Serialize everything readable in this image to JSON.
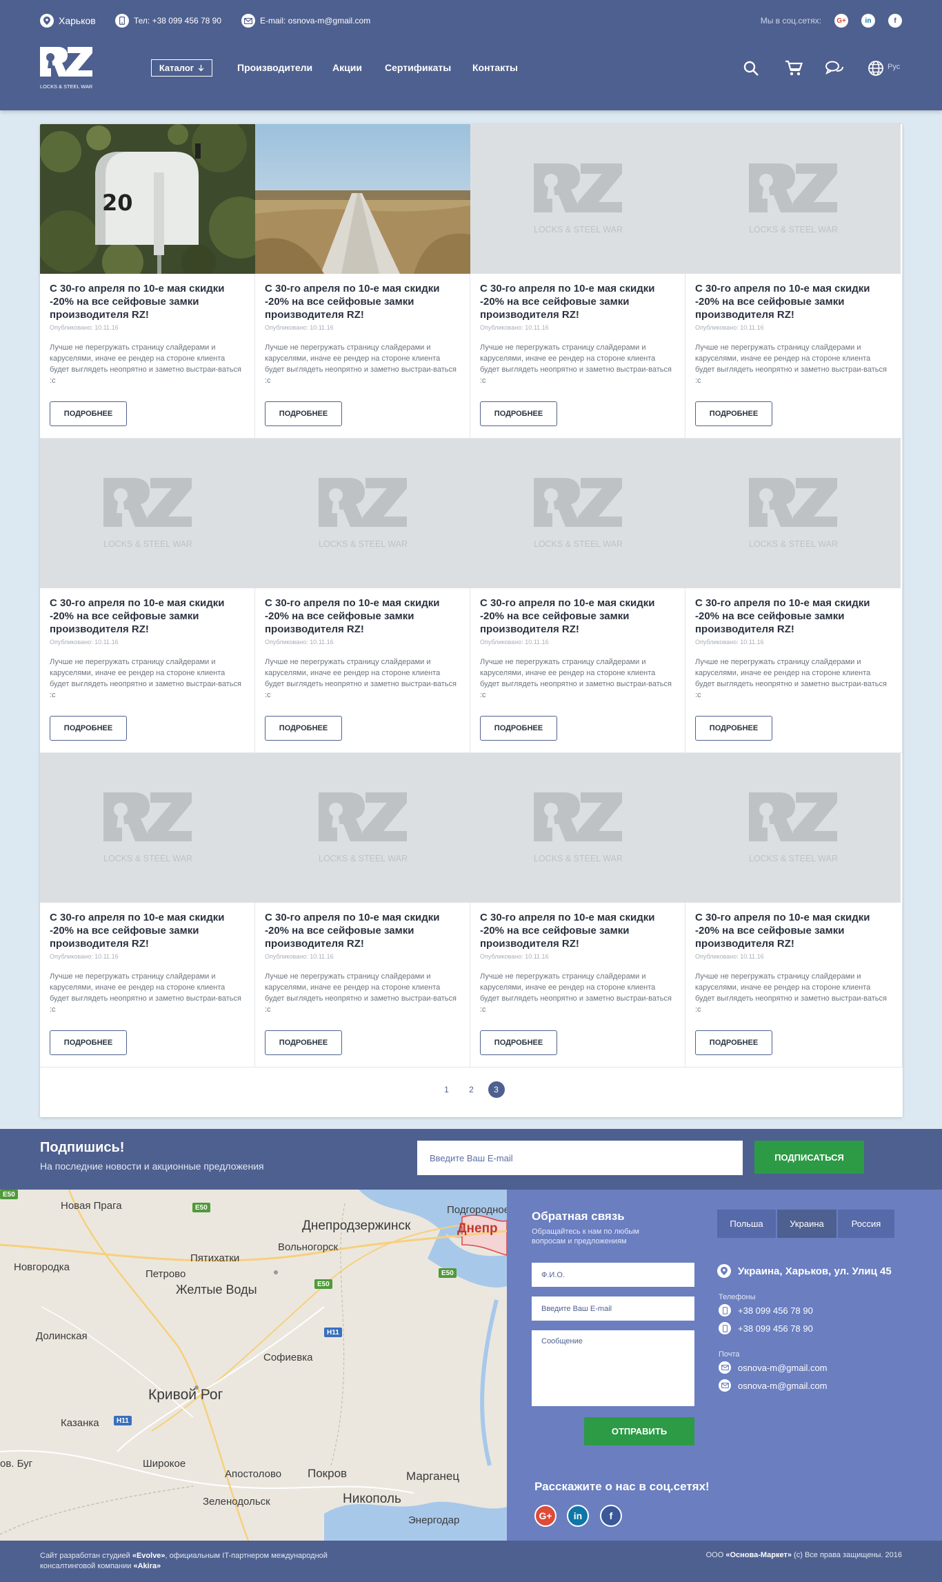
{
  "header": {
    "city": "Харьков",
    "phone": "Тел: +38 099 456 78 90",
    "email": "E-mail: osnova-m@gmail.com",
    "social_label": "Мы в соц.сетях:",
    "social": [
      "G+",
      "in",
      "f"
    ],
    "logo_letters": "RZ",
    "logo_sub": "LOCKS & STEEL WARES",
    "nav": {
      "catalog": "Каталог",
      "manufacturers": "Производители",
      "promotions": "Акции",
      "certificates": "Сертификаты",
      "contacts": "Контакты"
    },
    "language": "Рус"
  },
  "cards": [
    {
      "title": "С 30-го апреля по 10-е мая скидки -20% на все сейфовые замки производителя RZ!",
      "date": "Опубликовано: 10.11.16",
      "text": "Лучше не перегружать страницу слайдерами и каруселями, иначе ее рендер на стороне клиента будет выглядеть неопрятно и заметно выстраи-ваться :c",
      "button": "ПОДРОБНЕЕ",
      "image": "mailbox"
    },
    {
      "title": "С 30-го апреля по 10-е мая скидки -20% на все сейфовые замки производителя RZ!",
      "date": "Опубликовано: 10.11.16",
      "text": "Лучше не перегружать страницу слайдерами и каруселями, иначе ее рендер на стороне клиента будет выглядеть неопрятно и заметно выстраи-ваться :c",
      "button": "ПОДРОБНЕЕ",
      "image": "field"
    },
    {
      "title": "С 30-го апреля по 10-е мая скидки -20% на все сейфовые замки производителя RZ!",
      "date": "Опубликовано: 10.11.16",
      "text": "Лучше не перегружать страницу слайдерами и каруселями, иначе ее рендер на стороне клиента будет выглядеть неопрятно и заметно выстраи-ваться :c",
      "button": "ПОДРОБНЕЕ",
      "image": "placeholder"
    },
    {
      "title": "С 30-го апреля по 10-е мая скидки -20% на все сейфовые замки производителя RZ!",
      "date": "Опубликовано: 10.11.16",
      "text": "Лучше не перегружать страницу слайдерами и каруселями, иначе ее рендер на стороне клиента будет выглядеть неопрятно и заметно выстраи-ваться :c",
      "button": "ПОДРОБНЕЕ",
      "image": "placeholder"
    },
    {
      "title": "С 30-го апреля по 10-е мая скидки -20% на все сейфовые замки производителя RZ!",
      "date": "Опубликовано: 10.11.16",
      "text": "Лучше не перегружать страницу слайдерами и каруселями, иначе ее рендер на стороне клиента будет выглядеть неопрятно и заметно выстраи-ваться :c",
      "button": "ПОДРОБНЕЕ",
      "image": "placeholder"
    },
    {
      "title": "С 30-го апреля по 10-е мая скидки -20% на все сейфовые замки производителя RZ!",
      "date": "Опубликовано: 10.11.16",
      "text": "Лучше не перегружать страницу слайдерами и каруселями, иначе ее рендер на стороне клиента будет выглядеть неопрятно и заметно выстраи-ваться :c",
      "button": "ПОДРОБНЕЕ",
      "image": "placeholder"
    },
    {
      "title": "С 30-го апреля по 10-е мая скидки -20% на все сейфовые замки производителя RZ!",
      "date": "Опубликовано: 10.11.16",
      "text": "Лучше не перегружать страницу слайдерами и каруселями, иначе ее рендер на стороне клиента будет выглядеть неопрятно и заметно выстраи-ваться :c",
      "button": "ПОДРОБНЕЕ",
      "image": "placeholder"
    },
    {
      "title": "С 30-го апреля по 10-е мая скидки -20% на все сейфовые замки производителя RZ!",
      "date": "Опубликовано: 10.11.16",
      "text": "Лучше не перегружать страницу слайдерами и каруселями, иначе ее рендер на стороне клиента будет выглядеть неопрятно и заметно выстраи-ваться :c",
      "button": "ПОДРОБНЕЕ",
      "image": "placeholder"
    },
    {
      "title": "С 30-го апреля по 10-е мая скидки -20% на все сейфовые замки производителя RZ!",
      "date": "Опубликовано: 10.11.16",
      "text": "Лучше не перегружать страницу слайдерами и каруселями, иначе ее рендер на стороне клиента будет выглядеть неопрятно и заметно выстраи-ваться :c",
      "button": "ПОДРОБНЕЕ",
      "image": "placeholder"
    },
    {
      "title": "С 30-го апреля по 10-е мая скидки -20% на все сейфовые замки производителя RZ!",
      "date": "Опубликовано: 10.11.16",
      "text": "Лучше не перегружать страницу слайдерами и каруселями, иначе ее рендер на стороне клиента будет выглядеть неопрятно и заметно выстраи-ваться :c",
      "button": "ПОДРОБНЕЕ",
      "image": "placeholder"
    },
    {
      "title": "С 30-го апреля по 10-е мая скидки -20% на все сейфовые замки производителя RZ!",
      "date": "Опубликовано: 10.11.16",
      "text": "Лучше не перегружать страницу слайдерами и каруселями, иначе ее рендер на стороне клиента будет выглядеть неопрятно и заметно выстраи-ваться :c",
      "button": "ПОДРОБНЕЕ",
      "image": "placeholder"
    },
    {
      "title": "С 30-го апреля по 10-е мая скидки -20% на все сейфовые замки производителя RZ!",
      "date": "Опубликовано: 10.11.16",
      "text": "Лучше не перегружать страницу слайдерами и каруселями, иначе ее рендер на стороне клиента будет выглядеть неопрятно и заметно выстраи-ваться :c",
      "button": "ПОДРОБНЕЕ",
      "image": "placeholder"
    }
  ],
  "pagination": {
    "pages": [
      "1",
      "2",
      "3"
    ],
    "current": "3"
  },
  "subscribe": {
    "title": "Подпишись!",
    "text": "На последние новости и акционные предложения",
    "placeholder": "Введите Ваш E-mail",
    "button": "ПОДПИСАТЬСЯ"
  },
  "map": {
    "cities": [
      "Новая Прага",
      "Подгородное",
      "Днепродзержинск",
      "Днепр",
      "Вольногорск",
      "Новгородка",
      "Пятихатки",
      "Петрово",
      "Желтые Воды",
      "Долинская",
      "Софиевка",
      "Кривой Рог",
      "Казанка",
      "Широкое",
      "Апостолово",
      "Покров",
      "Марганец",
      "Зеленодольск",
      "Никополь",
      "Энергодар",
      "ов. Буг"
    ],
    "roads": [
      "E50",
      "E50",
      "E50",
      "E50",
      "H11",
      "H11"
    ]
  },
  "feedback": {
    "title": "Обратная связь",
    "subtitle": "Обращайтесь к нам по любым вопросам и предложениям",
    "name_placeholder": "Ф.И.О.",
    "email_placeholder": "Введите Ваш E-mail",
    "message_placeholder": "Сообщение",
    "button": "ОТПРАВИТЬ",
    "tell_title": "Расскажите о нас в соц.сетях!",
    "social": [
      "G+",
      "in",
      "f"
    ]
  },
  "contacts": {
    "tabs": [
      "Польша",
      "Украина",
      "Россия"
    ],
    "active_tab": "Украина",
    "address": "Украина, Харьков, ул. Улиц 45",
    "phones_label": "Телефоны",
    "phones": [
      "+38 099 456 78 90",
      "+38 099 456 78 90"
    ],
    "mail_label": "Почта",
    "emails": [
      "osnova-m@gmail.com",
      "osnova-m@gmail.com"
    ]
  },
  "footer": {
    "left_prefix": "Сайт разработан студией ",
    "studio": "«Evolve»",
    "left_mid": ", официальным IT-партнером международной консалтинговой компании ",
    "company": "«Akira»",
    "right_prefix": "ООО ",
    "owner": "«Основа-Маркет»",
    "right_suffix": " (с) Все права защищены. 2016"
  },
  "colors": {
    "header": "#4e608f",
    "accent_green": "#2d9a46",
    "contacts_bg": "#6a7ec0",
    "page_bg": "#dde9f2",
    "google_red": "#dd4b39",
    "linkedin_blue": "#0e76a8",
    "facebook_blue": "#3b5998"
  }
}
